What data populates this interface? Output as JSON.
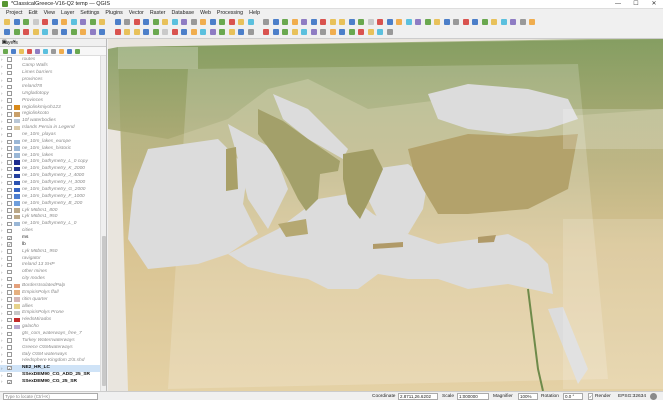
{
  "window": {
    "title": "*ClassicalGreece-V16-Q2 temp — QGIS",
    "minimize": "—",
    "maximize": "☐",
    "close": "✕"
  },
  "menu": [
    "Project",
    "Edit",
    "View",
    "Layer",
    "Settings",
    "Plugins",
    "Vector",
    "Raster",
    "Database",
    "Web",
    "Processing",
    "Help"
  ],
  "layers_panel": {
    "title": "Layers",
    "controls": "▣ ✕",
    "items": [
      {
        "name": "routes",
        "checked": false,
        "on": false,
        "swatch": ""
      },
      {
        "name": "Camp Walls",
        "checked": false,
        "on": false,
        "swatch": ""
      },
      {
        "name": "Limes barriers",
        "checked": false,
        "on": false,
        "swatch": ""
      },
      {
        "name": "provinces",
        "checked": false,
        "on": false,
        "swatch": ""
      },
      {
        "name": "Ireland78",
        "checked": false,
        "on": false,
        "swatch": ""
      },
      {
        "name": "Ungladotopy",
        "checked": false,
        "on": false,
        "swatch": ""
      },
      {
        "name": "Provinces",
        "checked": false,
        "on": false,
        "swatch": ""
      },
      {
        "name": "regiolinkmiyoh123",
        "checked": false,
        "on": false,
        "swatch": "#d88a1c"
      },
      {
        "name": "regiolinkcoto",
        "checked": false,
        "on": false,
        "swatch": "#c9a06a"
      },
      {
        "name": "10f waterbodies",
        "checked": false,
        "on": false,
        "swatch": "#b9c7d6"
      },
      {
        "name": "Islands Persia in Legend",
        "checked": false,
        "on": false,
        "swatch": "#d9c9a8"
      },
      {
        "name": "ne_10m_playas",
        "checked": false,
        "on": false,
        "swatch": ""
      },
      {
        "name": "ne_10m_lakes_europe",
        "checked": false,
        "on": false,
        "swatch": "#9ab7d6"
      },
      {
        "name": "ne_10m_lakes_historic",
        "checked": false,
        "on": false,
        "swatch": "#9ab7d6"
      },
      {
        "name": "ne_10m_lakes",
        "checked": false,
        "on": false,
        "swatch": "#9ab7d6"
      },
      {
        "name": "ne_10m_bathymetry_L_0 copy",
        "checked": false,
        "on": false,
        "swatch": "#1d2b8f"
      },
      {
        "name": "ne_10m_bathymetry_K_2000",
        "checked": false,
        "on": false,
        "swatch": "#20338f"
      },
      {
        "name": "ne_10m_bathymetry_J_4000",
        "checked": false,
        "on": false,
        "swatch": "#24409e"
      },
      {
        "name": "ne_10m_bathymetry_H_3000",
        "checked": false,
        "on": false,
        "swatch": "#2b51b0"
      },
      {
        "name": "ne_10m_bathymetry_G_2000",
        "checked": false,
        "on": false,
        "swatch": "#3664c2"
      },
      {
        "name": "ne_10m_bathymetry_F_1000",
        "checked": false,
        "on": false,
        "swatch": "#4d7ed0"
      },
      {
        "name": "ne_10m_bathymetry_B_200",
        "checked": false,
        "on": false,
        "swatch": "#6f9edc"
      },
      {
        "name": "Lyk M6bm1_800",
        "checked": false,
        "on": false,
        "swatch": "#bba887"
      },
      {
        "name": "Lyk M6bm1_950",
        "checked": false,
        "on": false,
        "swatch": "#bba887"
      },
      {
        "name": "ne_10m_bathymetry_L_0",
        "checked": false,
        "on": false,
        "swatch": "#9ab7d6"
      },
      {
        "name": "cities",
        "checked": false,
        "on": false,
        "swatch": ""
      },
      {
        "name": "ms",
        "checked": true,
        "on": true,
        "swatch": ""
      },
      {
        "name": "lb",
        "checked": true,
        "on": true,
        "swatch": ""
      },
      {
        "name": "Lyk M6bm1_950",
        "checked": false,
        "on": false,
        "swatch": ""
      },
      {
        "name": "ravigator",
        "checked": false,
        "on": false,
        "swatch": ""
      },
      {
        "name": "Ireland 13 SHP",
        "checked": false,
        "on": false,
        "swatch": ""
      },
      {
        "name": "other mines",
        "checked": false,
        "on": false,
        "swatch": ""
      },
      {
        "name": "city modes",
        "checked": false,
        "on": false,
        "swatch": ""
      },
      {
        "name": "BordersIsolatedPalp",
        "checked": false,
        "on": false,
        "swatch": "#e3a07c"
      },
      {
        "name": "EmpirisPolys ffall",
        "checked": false,
        "on": false,
        "swatch": "#e6b080"
      },
      {
        "name": "ritim quarter",
        "checked": false,
        "on": false,
        "swatch": "#d4b7b7"
      },
      {
        "name": "allies",
        "checked": false,
        "on": false,
        "swatch": "#e6d28c"
      },
      {
        "name": "EmpirisPolys Prone",
        "checked": false,
        "on": false,
        "swatch": "#c8c8c8"
      },
      {
        "name": "HiedsMirados",
        "checked": false,
        "on": false,
        "swatch": "#c22b2b"
      },
      {
        "name": "galacho",
        "checked": false,
        "on": false,
        "swatch": "#b9a9cf"
      },
      {
        "name": "gts_com_waterways_free_7",
        "checked": false,
        "on": false,
        "swatch": ""
      },
      {
        "name": "Turkey Waterrwaterways",
        "checked": false,
        "on": false,
        "swatch": ""
      },
      {
        "name": "Greece OSMwaterways",
        "checked": false,
        "on": false,
        "swatch": ""
      },
      {
        "name": "Italy OSM waterways",
        "checked": false,
        "on": false,
        "swatch": ""
      },
      {
        "name": "Hiedsphere Kingdom 2/S.shd",
        "checked": false,
        "on": false,
        "swatch": ""
      },
      {
        "name": "NE2_HR_LC",
        "checked": true,
        "on": true,
        "bold": true,
        "selected": true,
        "swatch": ""
      },
      {
        "name": "SSexDEM90_CG_ADD_25_SR",
        "checked": true,
        "on": true,
        "bold": true,
        "swatch": ""
      },
      {
        "name": "SSexDEM90_CG_25_SR",
        "checked": true,
        "on": true,
        "bold": true,
        "swatch": ""
      }
    ]
  },
  "statusbar": {
    "search_placeholder": "Type to locate (Ctrl+K)",
    "coordinate_label": "Coordinate",
    "coordinate_value": "2.8711,26.6202",
    "scale_label": "Scale",
    "scale_value": "1:000000",
    "magnifier_label": "Magnifier",
    "magnifier_value": "100%",
    "rotation_label": "Rotation",
    "rotation_value": "0.0 °",
    "render_label": "Render",
    "crs": "EPSG:32634"
  },
  "colors": {
    "sea": "#dcdcdc",
    "land": "#c9b27a",
    "selection": "#cfe3f7"
  }
}
